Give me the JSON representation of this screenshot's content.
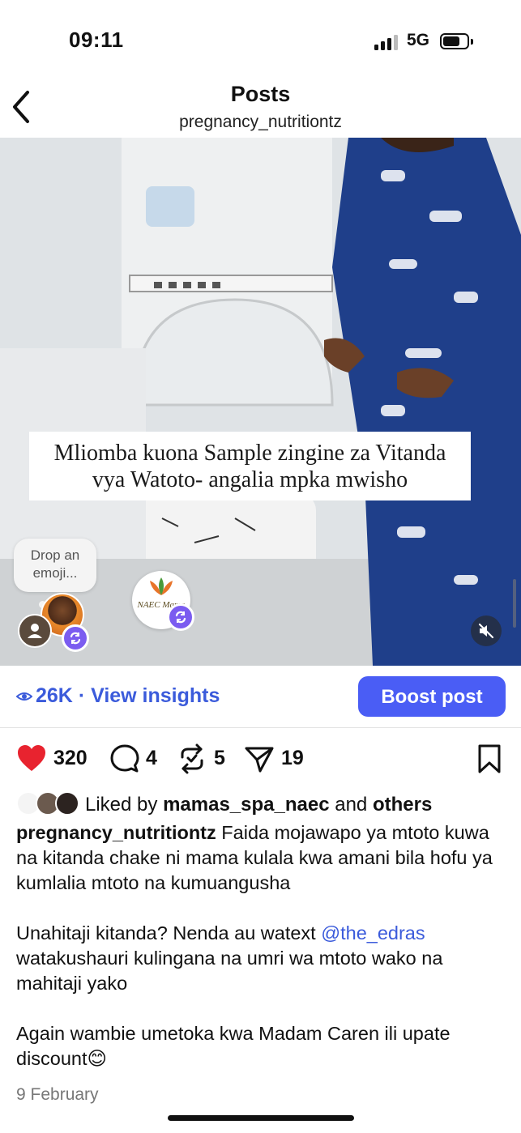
{
  "status_bar": {
    "time": "09:11",
    "network": "5G"
  },
  "header": {
    "title": "Posts",
    "username": "pregnancy_nutritiontz"
  },
  "media": {
    "overlay_caption_line1": "Mliomba kuona Sample zingine za Vitanda",
    "overlay_caption_line2": "vya Watoto- angalia mpka mwisho",
    "emoji_prompt_line1": "Drop an",
    "emoji_prompt_line2": "emoji...",
    "collab_logo_text": "NAEC Mama"
  },
  "insights": {
    "views": "26K",
    "separator": " · ",
    "link": "View insights"
  },
  "boost_label": "Boost post",
  "actions": {
    "likes": "320",
    "comments": "4",
    "reposts": "5",
    "shares": "19"
  },
  "liked_by": {
    "prefix": "Liked by ",
    "user": "mamas_spa_naec",
    "middle": " and ",
    "others": "others"
  },
  "caption": {
    "username": "pregnancy_nutritiontz",
    "para1": " Faida mojawapo ya mtoto kuwa na kitanda chake ni mama kulala kwa amani bila hofu ya kumlalia mtoto na kumuangusha",
    "para2_pre": "Unahitaji kitanda? Nenda au watext ",
    "mention": "@the_edras",
    "para2_post": " watakushauri kulingana na umri wa mtoto wako na mahitaji yako",
    "para3": "Again wambie umetoka kwa Madam Caren ili upate discount😊"
  },
  "date": "9 February",
  "colors": {
    "accent": "#4a5df5",
    "link": "#3b5bdb",
    "like": "#e8232f"
  }
}
